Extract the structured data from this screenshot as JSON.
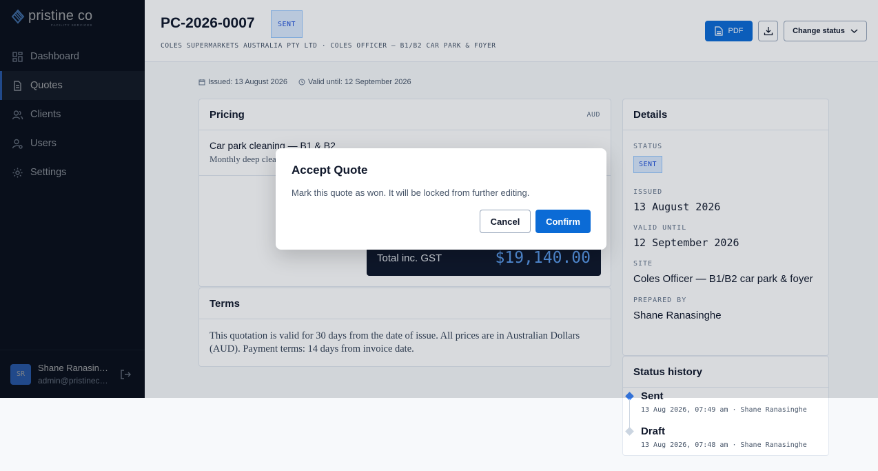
{
  "brand": {
    "name": "pristine co",
    "tagline": "FACILITY SERVICES"
  },
  "nav": [
    {
      "label": "Dashboard",
      "icon": "dashboard-icon"
    },
    {
      "label": "Quotes",
      "icon": "document-icon",
      "active": true
    },
    {
      "label": "Clients",
      "icon": "users-icon"
    },
    {
      "label": "Users",
      "icon": "user-gear-icon"
    },
    {
      "label": "Settings",
      "icon": "gear-icon"
    }
  ],
  "user": {
    "initials": "SR",
    "name": "Shane Ranasinghe",
    "email": "admin@pristineco.com.au"
  },
  "header": {
    "title": "PC-2026-0007",
    "status": "SENT",
    "subtitle": "COLES SUPERMARKETS AUSTRALIA PTY LTD · COLES OFFICER — B1/B2 CAR PARK & FOYER",
    "pdf_label": "PDF",
    "change_status_label": "Change status"
  },
  "meta": {
    "issued": "Issued: 13 August 2026",
    "valid_until": "Valid until: 12 September 2026"
  },
  "pricing": {
    "title": "Pricing",
    "currency": "AUD",
    "item_name": "Car park cleaning — B1 & B2",
    "item_desc": "Monthly deep clean",
    "total_label": "Total inc. GST",
    "total_value": "$19,140.00"
  },
  "terms": {
    "title": "Terms",
    "body": "This quotation is valid for 30 days from the date of issue. All prices are in Australian Dollars (AUD). Payment terms: 14 days from invoice date."
  },
  "details": {
    "title": "Details",
    "status_label": "STATUS",
    "status_value": "SENT",
    "issued_label": "ISSUED",
    "issued_value": "13 August 2026",
    "valid_label": "VALID UNTIL",
    "valid_value": "12 September 2026",
    "site_label": "SITE",
    "site_value": "Coles Officer — B1/B2 car park & foyer",
    "prepared_label": "PREPARED BY",
    "prepared_value": "Shane Ranasinghe"
  },
  "history": {
    "title": "Status history",
    "items": [
      {
        "status": "Sent",
        "meta": "13 Aug 2026, 07:49 am · Shane Ranasinghe",
        "color": "#3b82f6"
      },
      {
        "status": "Draft",
        "meta": "13 Aug 2026, 07:48 am · Shane Ranasinghe",
        "color": "#cbd5e1"
      }
    ]
  },
  "modal": {
    "title": "Accept Quote",
    "text": "Mark this quote as won. It will be locked from further editing.",
    "cancel": "Cancel",
    "confirm": "Confirm"
  },
  "colors": {
    "accent": "#0b6bd6",
    "sidebar": "#0f172a"
  }
}
